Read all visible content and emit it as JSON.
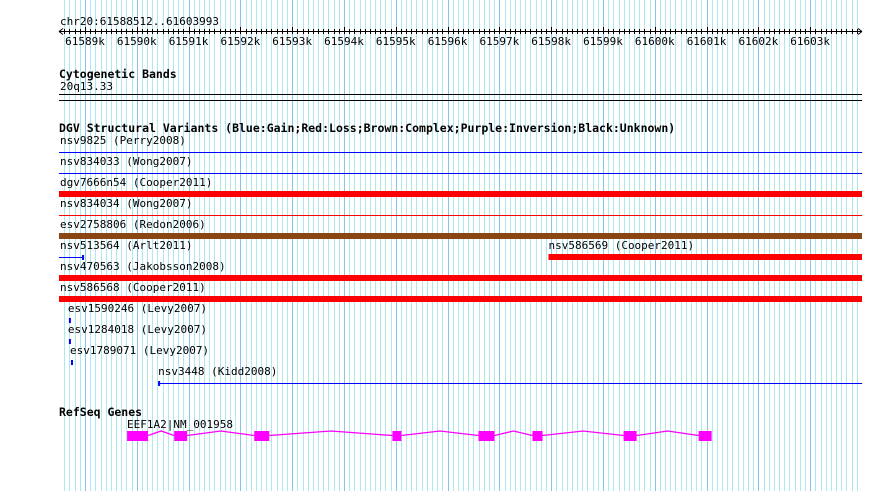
{
  "view": {
    "chrom": "chr20",
    "start": 61588512,
    "end": 61603993,
    "label": "chr20:61588512..61603993"
  },
  "ruler": {
    "ticks": [
      "61589k",
      "61590k",
      "61591k",
      "61592k",
      "61593k",
      "61594k",
      "61595k",
      "61596k",
      "61597k",
      "61598k",
      "61599k",
      "61600k",
      "61601k",
      "61602k",
      "61603k"
    ]
  },
  "tracks": {
    "cyto": {
      "title": "Cytogenetic Bands",
      "band": "20q13.33"
    },
    "dgv": {
      "title": "DGV Structural Variants (Blue:Gain;Red:Loss;Brown:Complex;Purple:Inversion;Black:Unknown)",
      "colors": {
        "gain": "#0000ff",
        "loss": "#ff0000",
        "complex": "#8b4513"
      },
      "features": [
        {
          "label": "nsv9825 (Perry2008)",
          "type": "gain",
          "style": "thin",
          "start": 61580000,
          "end": 61610000,
          "row": 0
        },
        {
          "label": "nsv834033 (Wong2007)",
          "type": "gain",
          "style": "thin",
          "start": 61580000,
          "end": 61610000,
          "row": 1
        },
        {
          "label": "dgv7666n54 (Cooper2011)",
          "type": "loss",
          "style": "thick",
          "start": 61580000,
          "end": 61610000,
          "row": 2
        },
        {
          "label": "nsv834034 (Wong2007)",
          "type": "loss",
          "style": "thin",
          "start": 61580000,
          "end": 61610000,
          "row": 3
        },
        {
          "label": "esv2758806 (Redon2006)",
          "type": "complex",
          "style": "thick",
          "start": 61580000,
          "end": 61610000,
          "row": 4
        },
        {
          "label": "nsv513564 (Arlt2011)",
          "type": "gain",
          "style": "thin",
          "start": 61580000,
          "end": 61588982,
          "row": 5
        },
        {
          "label": "nsv586569 (Cooper2011)",
          "type": "loss",
          "style": "thick",
          "start": 61597948,
          "end": 61610000,
          "row": 5
        },
        {
          "label": "nsv470563 (Jakobsson2008)",
          "type": "loss",
          "style": "thick",
          "start": 61580000,
          "end": 61610000,
          "row": 6
        },
        {
          "label": "nsv586568 (Cooper2011)",
          "type": "loss",
          "style": "thick",
          "start": 61580000,
          "end": 61610000,
          "row": 7
        },
        {
          "label": "esv1590246 (Levy2007)",
          "type": "gain",
          "style": "tick",
          "start": 61588690,
          "end": 61588730,
          "row": 8
        },
        {
          "label": "esv1284018 (Levy2007)",
          "type": "gain",
          "style": "tick",
          "start": 61588690,
          "end": 61588730,
          "row": 9
        },
        {
          "label": "esv1789071 (Levy2007)",
          "type": "gain",
          "style": "tick",
          "start": 61588730,
          "end": 61588770,
          "row": 10
        },
        {
          "label": "nsv3448 (Kidd2008)",
          "type": "gain",
          "style": "thin",
          "start": 61590412,
          "end": 61610000,
          "row": 11
        }
      ]
    },
    "refseq": {
      "title": "RefSeq Genes",
      "color": "#ff00ff",
      "gene": {
        "label": "EEF1A2|NM_001958",
        "exons": [
          [
            61589813,
            61590218
          ],
          [
            61590722,
            61590973
          ],
          [
            61592268,
            61592558
          ],
          [
            61594935,
            61595109
          ],
          [
            61596597,
            61596906
          ],
          [
            61597640,
            61597833
          ],
          [
            61599398,
            61599649
          ],
          [
            61600847,
            61601098
          ]
        ]
      }
    }
  }
}
